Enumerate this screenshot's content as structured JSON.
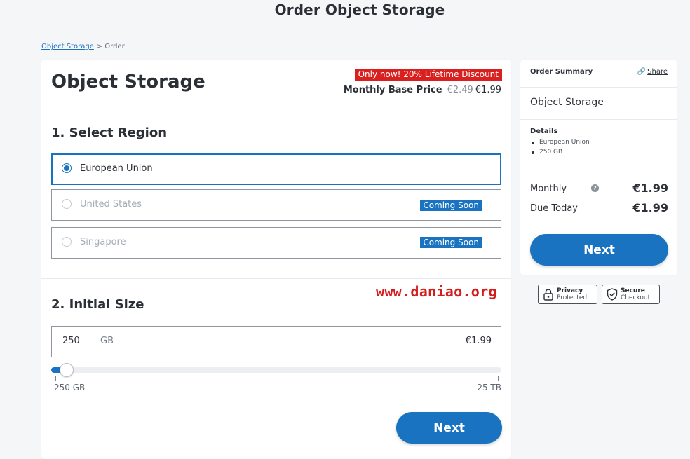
{
  "page": {
    "title": "Order Object Storage"
  },
  "breadcrumb": {
    "link": "Object Storage",
    "separator": ">",
    "current": "Order"
  },
  "product": {
    "title": "Object Storage",
    "discount_badge": "Only now! 20% Lifetime Discount",
    "base_price_label": "Monthly Base Price",
    "old_price": "€2.49",
    "new_price": "€1.99"
  },
  "region": {
    "heading": "1. Select Region",
    "options": [
      {
        "label": "European Union",
        "selected": true,
        "badge": ""
      },
      {
        "label": "United States",
        "selected": false,
        "badge": "Coming Soon"
      },
      {
        "label": "Singapore",
        "selected": false,
        "badge": "Coming Soon"
      }
    ]
  },
  "watermark": "www.daniao.org",
  "size": {
    "heading": "2. Initial Size",
    "value": "250",
    "unit": "GB",
    "price": "€1.99",
    "slider_min_label": "250 GB",
    "slider_max_label": "25 TB",
    "slider_fraction": 0.02
  },
  "buttons": {
    "next": "Next"
  },
  "summary": {
    "heading": "Order Summary",
    "share": "Share",
    "product": "Object Storage",
    "details_label": "Details",
    "details": [
      "European Union",
      "250 GB"
    ],
    "monthly_label": "Monthly",
    "help_glyph": "?",
    "monthly_price": "€1.99",
    "due_label": "Due Today",
    "due_price": "€1.99"
  },
  "trust": {
    "privacy": {
      "line1": "Privacy",
      "line2": "Protected"
    },
    "secure": {
      "line1": "Secure",
      "line2": "Checkout"
    }
  },
  "colors": {
    "accent": "#1a73c0",
    "discount": "#d9201f",
    "watermark": "#d61b1b"
  }
}
